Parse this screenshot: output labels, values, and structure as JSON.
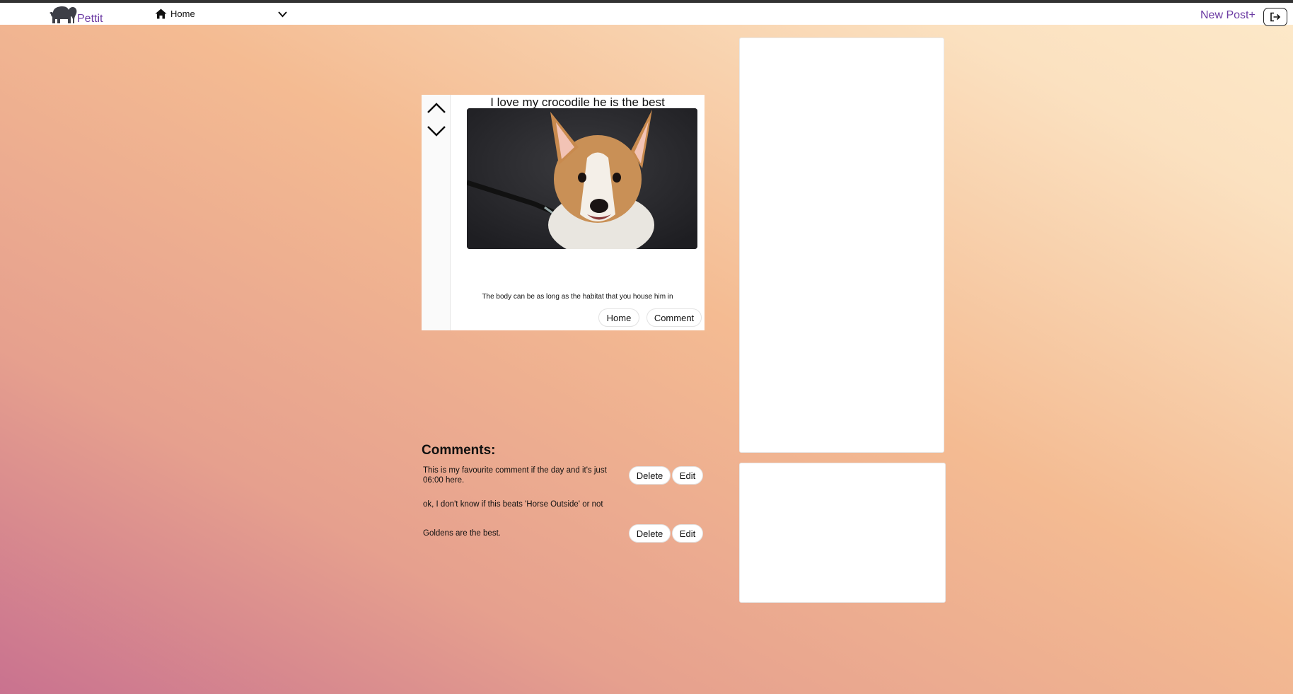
{
  "app": {
    "brand": "Pettit"
  },
  "nav": {
    "home_label": "Home",
    "new_post_label": "New Post+"
  },
  "post": {
    "title": "I love my crocodile he is the best",
    "body": "The body can be as long as the habitat that you house him in",
    "home_button": "Home",
    "comment_button": "Comment"
  },
  "comments": {
    "heading": "Comments:",
    "items": [
      {
        "text": "This is my favourite comment if the day and it's just 06:00 here.",
        "delete_label": "Delete",
        "edit_label": "Edit"
      },
      {
        "text": "ok, I don't know if this beats 'Horse Outside' or not"
      },
      {
        "text": "Goldens are the best.",
        "delete_label": "Delete",
        "edit_label": "Edit"
      }
    ]
  },
  "icons": {
    "logo": "elephant-icon",
    "home": "home-icon",
    "dropdown": "chevron-down-icon",
    "logout": "logout-icon",
    "upvote": "chevron-up-icon",
    "downvote": "chevron-down-icon"
  },
  "colors": {
    "brand": "#6b3aa3",
    "background_top": "#fde9c9",
    "background_bottom": "#c9728f"
  }
}
